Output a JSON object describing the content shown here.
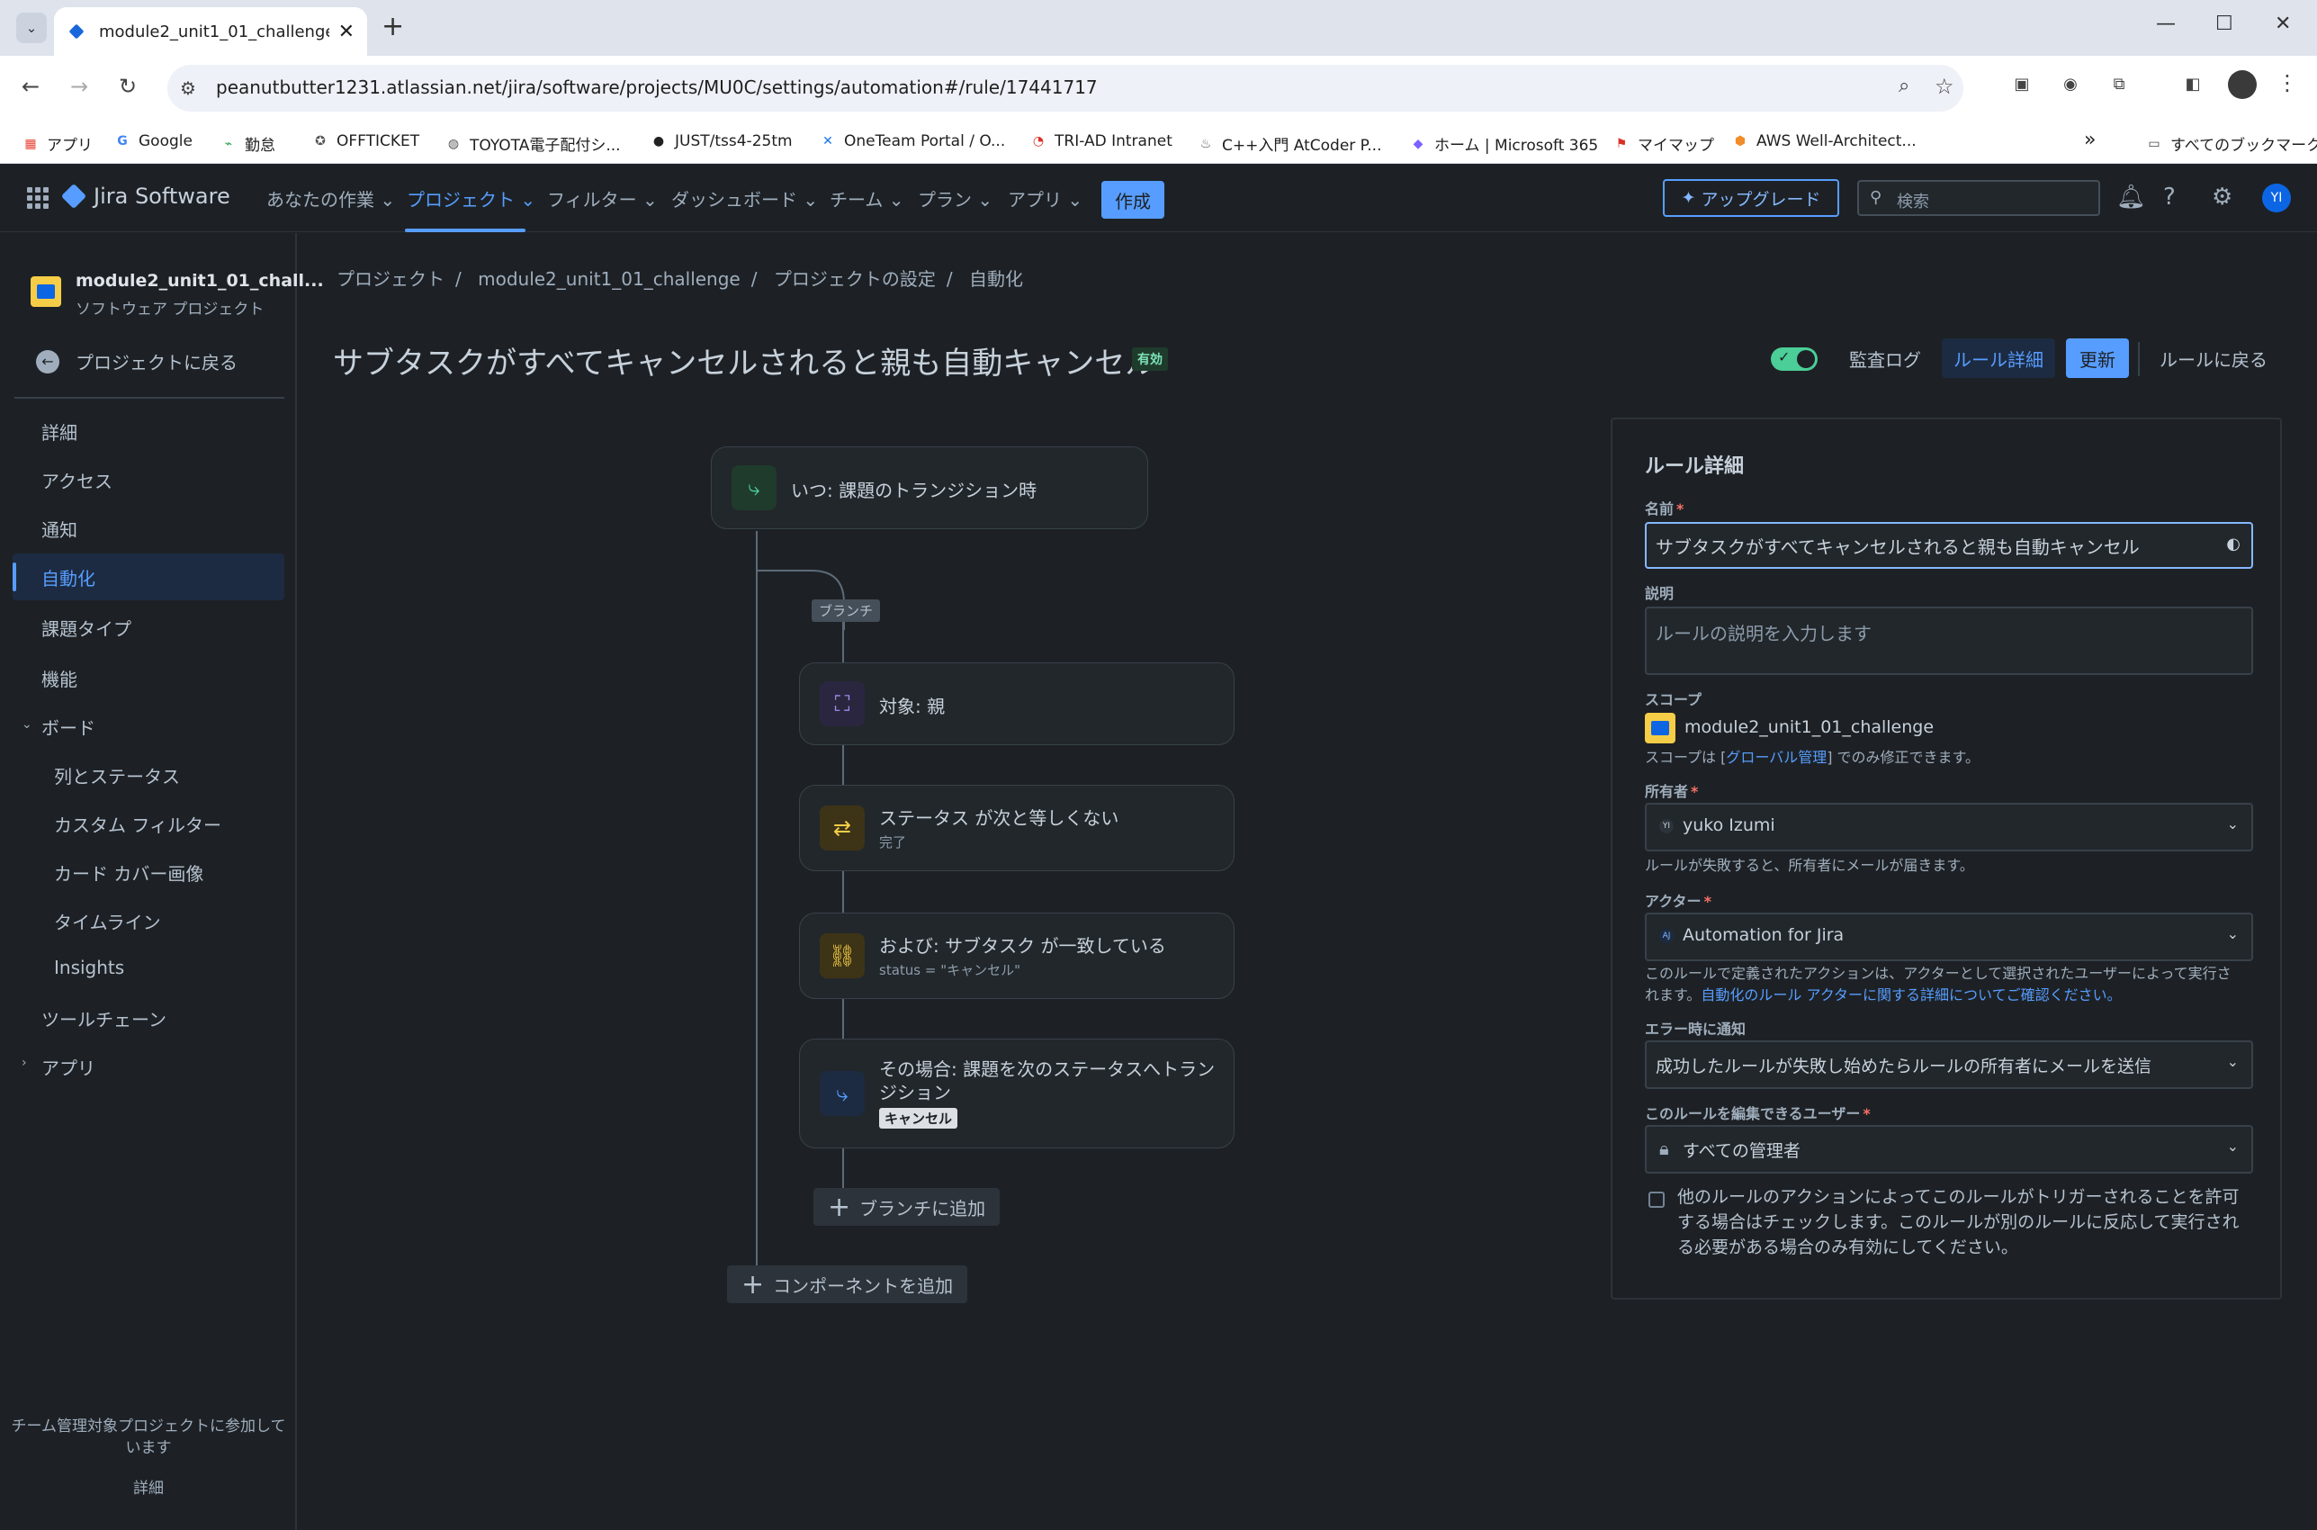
{
  "browser": {
    "tab_title": "module2_unit1_01_challenge - ",
    "url": "peanutbutter1231.atlassian.net/jira/software/projects/MU0C/settings/automation#/rule/17441717",
    "bookmarks": [
      {
        "label": "アプリ",
        "icon": "apps-grid-icon",
        "color": "#e94235"
      },
      {
        "label": "Google",
        "icon": "google-icon",
        "color": "#4285f4"
      },
      {
        "label": "勤怠",
        "icon": "attendance-icon",
        "color": "#2aa14a"
      },
      {
        "label": "OFFTICKET",
        "icon": "offticket-icon",
        "color": "#555555"
      },
      {
        "label": "TOYOTA電子配付シ...",
        "icon": "globe-icon",
        "color": "#555555"
      },
      {
        "label": "JUST/tss4-25tm",
        "icon": "github-icon",
        "color": "#222222"
      },
      {
        "label": "OneTeam Portal / O...",
        "icon": "oneteam-icon",
        "color": "#1a73e8"
      },
      {
        "label": "TRI-AD Intranet",
        "icon": "tri-ad-icon",
        "color": "#d93025"
      },
      {
        "label": "C++入門 AtCoder P...",
        "icon": "atcoder-icon",
        "color": "#555555"
      },
      {
        "label": "ホーム | Microsoft 365",
        "icon": "m365-icon",
        "color": "#7b61ff"
      },
      {
        "label": "マイマップ",
        "icon": "map-pin-icon",
        "color": "#d93025"
      },
      {
        "label": "AWS Well-Architect...",
        "icon": "aws-icon",
        "color": "#f28c28"
      }
    ],
    "all_bookmarks": "すべてのブックマーク",
    "more_bookmarks": "»"
  },
  "jira_nav": {
    "product": "Jira Software",
    "menus": [
      "あなたの作業",
      "プロジェクト",
      "フィルター",
      "ダッシュボード",
      "チーム",
      "プラン",
      "アプリ"
    ],
    "active_menu": "プロジェクト",
    "create": "作成",
    "upgrade": "アップグレード",
    "search_placeholder": "検索",
    "avatar_initials": "YI"
  },
  "sidebar": {
    "project_name": "module2_unit1_01_chall...",
    "project_type": "ソフトウェア プロジェクト",
    "back_label": "プロジェクトに戻る",
    "items": [
      "詳細",
      "アクセス",
      "通知",
      "自動化",
      "課題タイプ",
      "機能",
      "ボード",
      "列とステータス",
      "カスタム フィルター",
      "カード カバー画像",
      "タイムライン",
      "Insights",
      "ツールチェーン",
      "アプリ"
    ],
    "active_item": "自動化",
    "footer_text": "チーム管理対象プロジェクトに参加しています",
    "footer_link": "詳細"
  },
  "breadcrumb": [
    "プロジェクト",
    "module2_unit1_01_challenge",
    "プロジェクトの設定",
    "自動化"
  ],
  "rule": {
    "title": "サブタスクがすべてキャンセルされると親も自動キャンセル",
    "status_badge": "有効",
    "enabled": true,
    "audit_log": "監査ログ",
    "rule_details_btn": "ルール詳細",
    "update_btn": "更新",
    "back_to_rules": "ルールに戻る"
  },
  "canvas": {
    "trigger": {
      "title": "いつ: 課題のトランジション時"
    },
    "branch_label": "ブランチ",
    "branch_nodes": [
      {
        "title": "対象: 親",
        "sub": ""
      },
      {
        "title": "ステータス が次と等しくない",
        "sub": "完了"
      },
      {
        "title": "および: サブタスク が一致している",
        "sub": "status = \"キャンセル\""
      },
      {
        "title": "その場合: 課題を次のステータスへトランジション",
        "tag": "キャンセル"
      }
    ],
    "add_to_branch": "ブランチに追加",
    "add_component": "コンポーネントを追加"
  },
  "panel": {
    "heading": "ルール詳細",
    "name_label": "名前",
    "name_value": "サブタスクがすべてキャンセルされると親も自動キャンセル",
    "desc_label": "説明",
    "desc_placeholder": "ルールの説明を入力します",
    "scope_label": "スコープ",
    "scope_value": "module2_unit1_01_challenge",
    "scope_help_pre": "スコープは [",
    "scope_help_link": "グローバル管理",
    "scope_help_post": "] でのみ修正できます。",
    "owner_label": "所有者",
    "owner_value": "yuko Izumi",
    "owner_initials": "YI",
    "owner_help": "ルールが失敗すると、所有者にメールが届きます。",
    "actor_label": "アクター",
    "actor_value": "Automation for Jira",
    "actor_initials": "AJ",
    "actor_help_1": "このルールで定義されたアクションは、アクターとして選択されたユーザーによって実行さ",
    "actor_help_2_pre": "れます。",
    "actor_help_link": "自動化のルール アクターに関する詳細についてご確認ください。",
    "error_label": "エラー時に通知",
    "error_value": "成功したルールが失敗し始めたらルールの所有者にメールを送信",
    "editors_label": "このルールを編集できるユーザー",
    "editors_value": "すべての管理者",
    "checkbox_text": "他のルールのアクションによってこのルールがトリガーされることを許可する場合はチェックします。このルールが別のルールに反応して実行される必要がある場合のみ有効にしてください。",
    "checkbox_checked": false
  }
}
